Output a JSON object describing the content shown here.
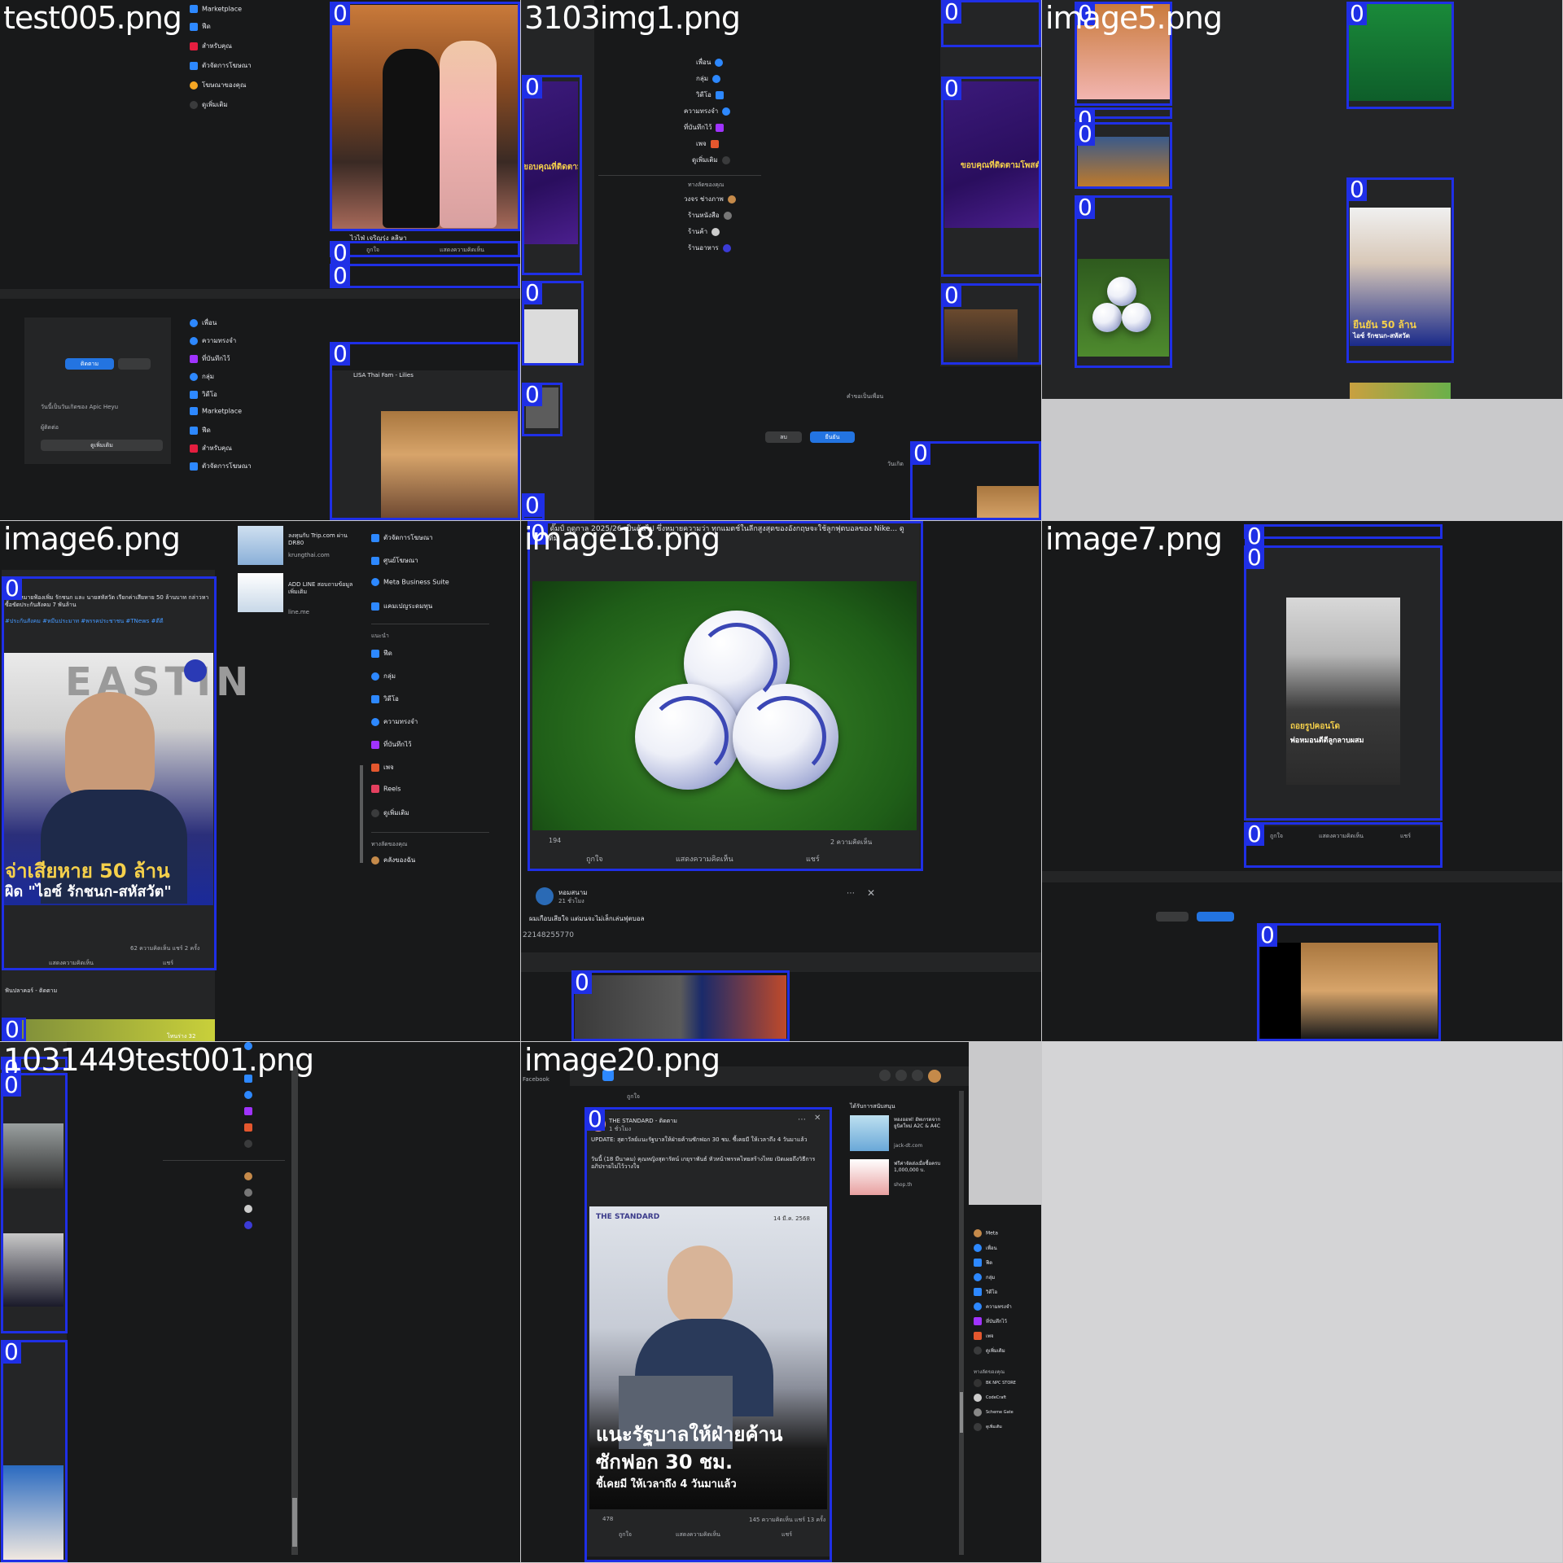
{
  "tiles": [
    {
      "name": "test005.png"
    },
    {
      "name": "3103img1.png"
    },
    {
      "name": "image5.png"
    },
    {
      "name": "image6.png"
    },
    {
      "name": "image18.png"
    },
    {
      "name": "image7.png"
    },
    {
      "name": "1031449test001.png"
    },
    {
      "name": "image20.png"
    }
  ],
  "detection_label": "0",
  "colors": {
    "detection_box": "#1f2fe6",
    "fb_dark_bg": "#18191a",
    "fb_card_bg": "#242526",
    "fb_blue": "#2374e1"
  },
  "tile1": {
    "nav": [
      "Marketplace",
      "ฟีด",
      "สำหรับคุณ",
      "ตัวจัดการโฆษณา",
      "โฆษณาของคุณ",
      "ดูเพิ่มเติม"
    ],
    "nav2": [
      "เพื่อน",
      "ความทรงจำ",
      "ที่บันทึกไว้",
      "กลุ่ม",
      "วิดีโอ",
      "Marketplace",
      "ฟีด",
      "สำหรับคุณ",
      "ตัวจัดการโฆษณา"
    ],
    "post_author": "LISA Thai Fam - Lilies",
    "post_caption": "ไวไฟ่ เจริญรุ่ง ลลิษา",
    "follow_btn": "ติดตาม",
    "like_label": "ถูกใจ",
    "comment_label": "แสดงความคิดเห็น",
    "see_more": "ดูเพิ่มเติม",
    "promo_label": "วันนี้เป็นวันเกิดของ Apic Heyu",
    "contacts_heading": "ผู้ติดต่อ"
  },
  "tile2": {
    "filename_overlay": "3103img1.png",
    "banner_text": "ขอบคุณที่ติดตามโพสต์ไลฟ์",
    "shortcuts_heading": "ทางลัดของคุณ",
    "nav": [
      "เพื่อน",
      "กลุ่ม",
      "วิดีโอ",
      "ความทรงจำ",
      "ที่บันทึกไว้",
      "เพจ",
      "ดูเพิ่มเติม"
    ],
    "shortcuts": [
      "วงจร ช่างภาพ",
      "ร้านหนังสือ",
      "ร้านค้า",
      "ร้านอาหาร"
    ],
    "confirm_btn": "ยืนยัน",
    "delete_btn": "ลบ",
    "friend_requests": "คำขอเป็นเพื่อน",
    "birthday_heading": "วันเกิด"
  },
  "tile3": {
    "headline": "ยืนยัน 50 ล้าน",
    "subline": "ไอซ์ รักชนก-สหัสวัต"
  },
  "tile4": {
    "headline_line1": "จ่าเสียหาย 50 ล้าน",
    "headline_line2": "ผิด \"ไอซ์ รักชนก-สหัสวัต\"",
    "post_text": "ใช้ ส่งหมายฟ้องเพิ่ม รักชนก และ นายสหัสวัต เรียกค่าเสียหาย 50 ล้านบาท กล่าวหาซื้อขัดประกันสังคม 7 พันล้าน",
    "hashtags": "#ประกันสังคม #หมีนประมาท #พรรคประชาชน #TNews #ดีดี",
    "brand_letters": "EASTIN",
    "comments": "62 ความคิดเห็น แชร์ 2 ครั้ง",
    "comment_btn": "แสดงความคิดเห็น",
    "share_btn": "แชร์",
    "sponsor1_title": "ลงทุนกับ Trip.com ผ่าน DR80",
    "sponsor1_domain": "krungthai.com",
    "sponsor2_title": "ADD LINE สอบถามข้อมูลเพิ่มเติม",
    "sponsor2_domain": "line.me",
    "menu": [
      "ตัวจัดการโฆษณา",
      "ศูนย์โฆษณา",
      "Meta Business Suite",
      "แคมเปญระดมทุน"
    ],
    "more_menu": [
      "ฟีด",
      "กลุ่ม",
      "วิดีโอ",
      "ความทรงจำ",
      "ที่บันทึกไว้",
      "เพจ",
      "Reels",
      "ดูเพิ่มเติม"
    ],
    "section_explore": "แนะนำ",
    "section_shortcuts": "ทางลัดของคุณ",
    "shortcut_item": "คลังของฉัน",
    "bottom_post_author": "ฟันปลาคอร์ - ติดตาม",
    "bottom_badge": "โทนร่าง 32"
  },
  "tile5": {
    "post_text": "ไนซ์ ดั๊มป์ ฤดูกาล 2025/26 เป็นต้นไป ซึ่งหมายความว่า ทุกแมตช์ในลีกสูงสุดของอังกฤษจะใช้ลูกฟุตบอลของ Nike... ดูเพิ่มเติม",
    "reactions": "194",
    "comments": "2 ความคิดเห็น",
    "like_btn": "ถูกใจ",
    "comment_btn": "แสดงความคิดเห็น",
    "share_btn": "แชร์",
    "next_author": "หอมสนาม",
    "next_time": "21 ชั่วโมง",
    "next_text": "ผมเกือบเสียใจ แต่มนจะไม่เล็กเล่นฟุตบอล",
    "number_row": "22148255770"
  },
  "tile6": {
    "video_caption1": "ถอยรูปคอนโด",
    "video_caption2": "พ่อหมอนตีตีลูกลาบผสม",
    "like_btn": "ถูกใจ",
    "comment_btn": "แสดงความคิดเห็น",
    "share_btn": "แชร์"
  },
  "tile8": {
    "tabs_label": "ถูกใจ",
    "page_name": "THE STANDARD - ติดตาม",
    "post_time": "1 ชั่วโมง",
    "update_text": "UPDATE: สุดาวัลย์แนะรัฐบาลให้ฝ่ายค้านซักฟอก 30 ชม. ชี้เคยมี ให้เวลาถึง 4 วันมาแล้ว",
    "body_text": "วันนี้ (18 มีนาคม) คุณหญิงสุดารัตน์ เกยุราพันธ์ หัวหน้าพรรคไทยสร้างไทย เปิดเผยถึงวิธีการอภิปรายไม่ไว้วางใจ",
    "image_brand": "THE STANDARD",
    "image_date": "14 มี.ค. 2568",
    "headline_line1": "แนะรัฐบาลให้ฝ่ายค้าน",
    "headline_line2": "ซักฟอก 30 ชม.",
    "headline_line3": "ชี้เคยมี ให้เวลาถึง 4 วันมาแล้ว",
    "reactions": "478",
    "comments": "145 ความคิดเห็น แชร์ 13 ครั้ง",
    "like_btn": "ถูกใจ",
    "comment_btn": "แสดงความคิดเห็น",
    "share_btn": "แชร์",
    "sponsored_heading": "ได้รับการสนับสนุน",
    "ad1_title": "ทองออฟ! อัพเกรดจาก ยูนิตใหม่ A2C & A4C",
    "ad1_domain": "jack-dt.com",
    "ad2_title": "ฟรีค่าจัดส่งเมื่อซื้อครบ 1,000,000 บ.",
    "ad2_domain": "shop.th",
    "right_nav": [
      "Meta",
      "เพื่อน",
      "ฟีด",
      "กลุ่ม",
      "วิดีโอ",
      "ความทรงจำ",
      "ที่บันทึกไว้",
      "เพจ",
      "ดูเพิ่มเติม"
    ],
    "right_shortcuts_heading": "ทางลัดของคุณ",
    "right_shortcuts": [
      "BK NPC STORE",
      "CodeCraft",
      "Scheme Gate",
      "ดูเพิ่มเติม"
    ],
    "site_label": "Facebook"
  }
}
